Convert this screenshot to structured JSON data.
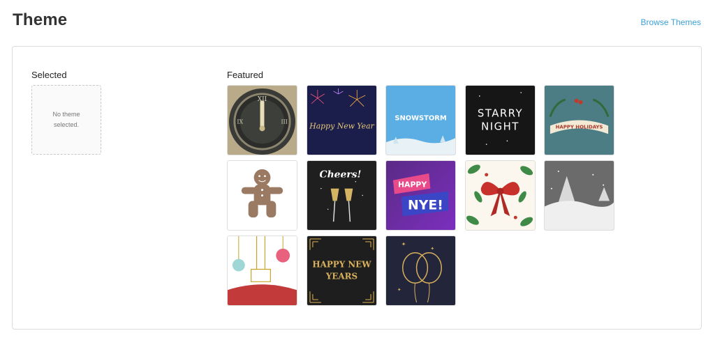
{
  "header": {
    "title": "Theme",
    "browse_link": "Browse Themes"
  },
  "selected": {
    "heading": "Selected",
    "empty_text": "No theme selected."
  },
  "featured": {
    "heading": "Featured",
    "themes": [
      {
        "name": "Clock Midnight",
        "text": ""
      },
      {
        "name": "Happy New Year Fireworks",
        "text": "Happy New Year"
      },
      {
        "name": "Snowstorm",
        "text": "SNOWSTORM"
      },
      {
        "name": "Starry Night",
        "text_line1": "STARRY",
        "text_line2": "NIGHT"
      },
      {
        "name": "Happy Holidays",
        "text": "HAPPY HOLIDAYS"
      },
      {
        "name": "Gingerbread",
        "text": ""
      },
      {
        "name": "Cheers",
        "text": "Cheers!"
      },
      {
        "name": "Happy NYE",
        "text_line1": "HAPPY",
        "text_line2": "NYE!"
      },
      {
        "name": "Red Bow",
        "text": ""
      },
      {
        "name": "Winter Trees",
        "text": ""
      },
      {
        "name": "Ornaments",
        "text": ""
      },
      {
        "name": "Happy New Years Deco",
        "text_line1": "HAPPY NEW",
        "text_line2": "YEARS"
      },
      {
        "name": "Balloons",
        "text": ""
      }
    ]
  },
  "colors": {
    "accent_link": "#3b9fd6",
    "panel_border": "#dcdcdc"
  }
}
